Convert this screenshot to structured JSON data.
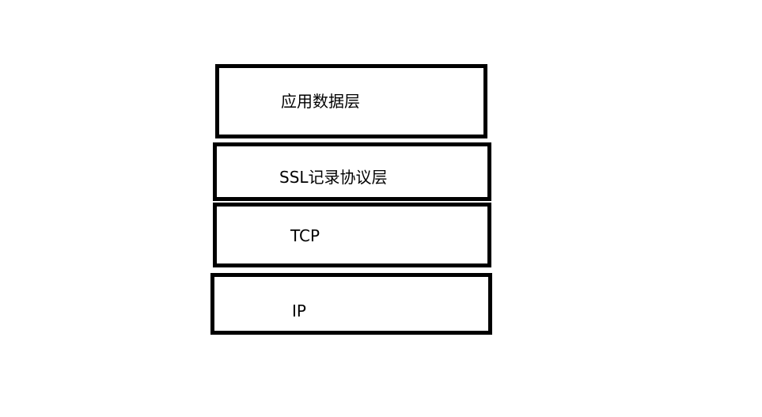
{
  "layers": [
    {
      "label": "应用数据层"
    },
    {
      "label": "SSL记录协议层"
    },
    {
      "label": "TCP"
    },
    {
      "label": "IP"
    }
  ]
}
